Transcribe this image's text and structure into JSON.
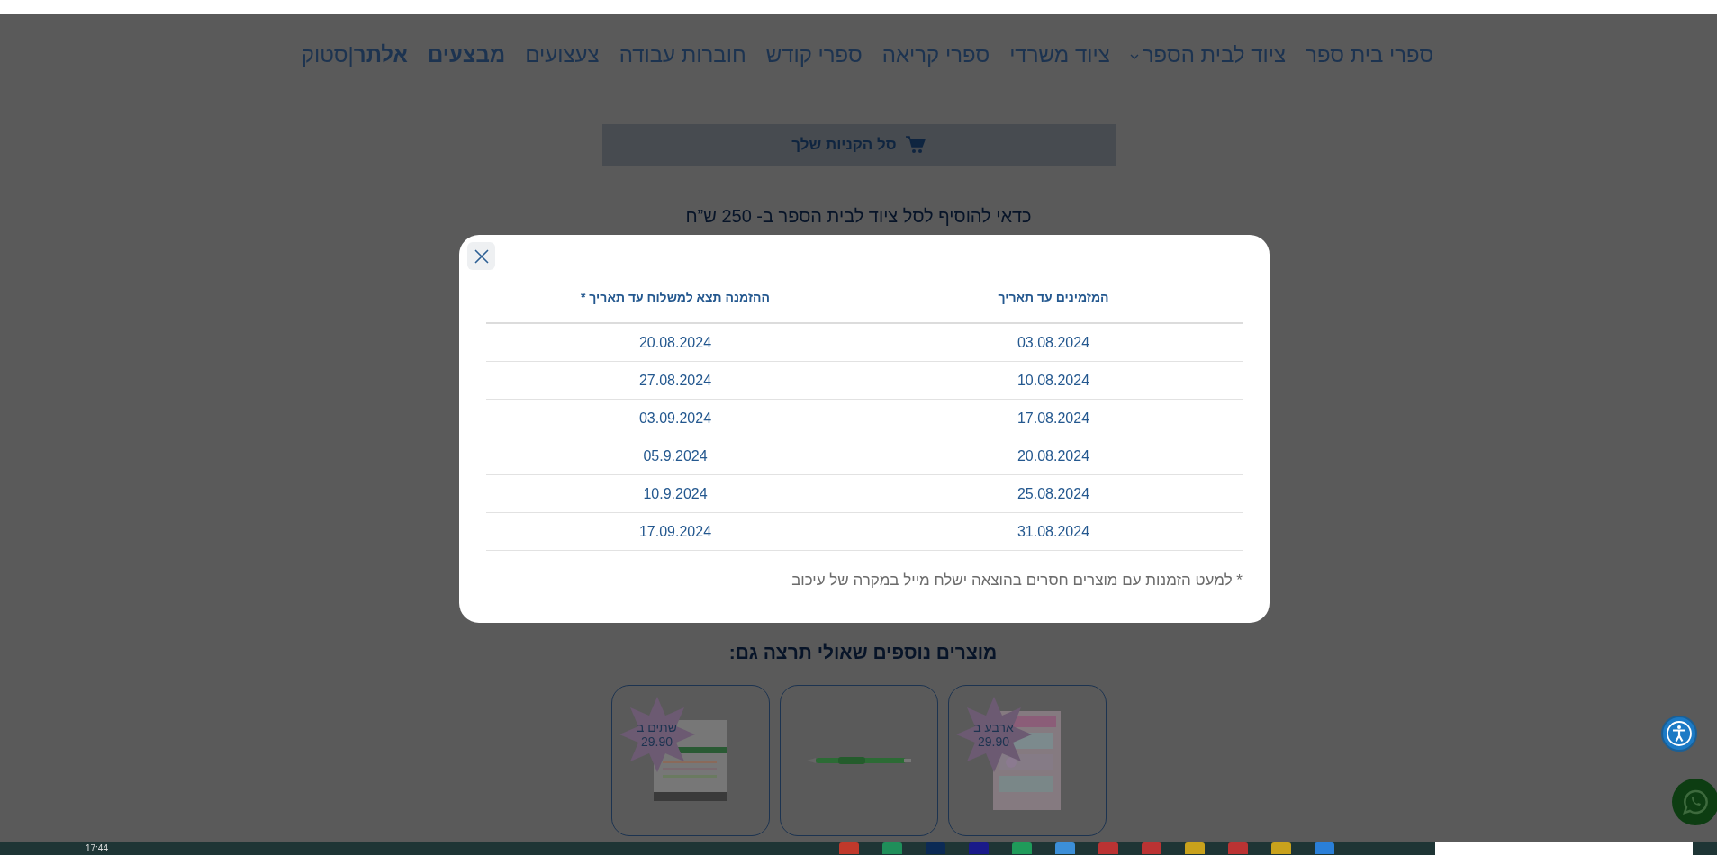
{
  "nav": {
    "items": [
      {
        "label": "ספרי בית ספר",
        "bold": false,
        "dropdown": false
      },
      {
        "label": "ציוד לבית הספר",
        "bold": false,
        "dropdown": true
      },
      {
        "label": "ציוד משרדי",
        "bold": false,
        "dropdown": false
      },
      {
        "label": "ספרי קריאה",
        "bold": false,
        "dropdown": false
      },
      {
        "label": "ספרי קודש",
        "bold": false,
        "dropdown": false
      },
      {
        "label": "חוברות עבודה",
        "bold": false,
        "dropdown": false
      },
      {
        "label": "צעצועים",
        "bold": false,
        "dropdown": false
      },
      {
        "label": "מבצעים",
        "bold": true,
        "dropdown": false
      },
      {
        "label": "**אלתר**|סטוק",
        "bold": false,
        "dropdown": false
      }
    ]
  },
  "cart": {
    "label": "סל הקניות שלך"
  },
  "promo": {
    "text": "כדאי להוסיף לסל ציוד לבית הספר ב- 250 ש”ח"
  },
  "modal": {
    "columns": [
      "המזמינים עד תאריך",
      "ההזמנה תצא למשלוח עד תאריך *"
    ],
    "rows": [
      [
        "03.08.2024",
        "20.08.2024"
      ],
      [
        "10.08.2024",
        "27.08.2024"
      ],
      [
        "17.08.2024",
        "03.09.2024"
      ],
      [
        "20.08.2024",
        "05.9.2024"
      ],
      [
        "25.08.2024",
        "10.9.2024"
      ],
      [
        "31.08.2024",
        "17.09.2024"
      ]
    ],
    "footnote": "* למעט הזמנות עם מוצרים חסרים בהוצאה ישלח מייל במקרה של עיכוב"
  },
  "related": {
    "title": "מוצרים נוספים שאולי תרצה גם:",
    "products": [
      {
        "kind": "sheet",
        "badge": {
          "label": "ארבע ב",
          "price": "29.90"
        }
      },
      {
        "kind": "pen"
      },
      {
        "kind": "box",
        "badge": {
          "label": "שתים ב",
          "price": "29.90"
        }
      }
    ]
  },
  "taskbar": {
    "time": "17:44"
  }
}
